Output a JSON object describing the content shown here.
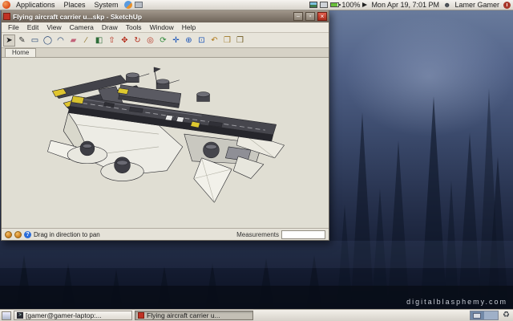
{
  "desktop": {
    "watermark": "digitalblasphemy.com"
  },
  "top_panel": {
    "menus": [
      {
        "label": "Applications"
      },
      {
        "label": "Places"
      },
      {
        "label": "System"
      }
    ],
    "battery_level": "100%",
    "clock": "Mon Apr 19,  7:01 PM",
    "user_name": "Lamer Gamer"
  },
  "window": {
    "title": "Flying aircraft carrier u...skp - SketchUp",
    "menu_items": [
      "File",
      "Edit",
      "View",
      "Camera",
      "Draw",
      "Tools",
      "Window",
      "Help"
    ],
    "tab_label": "Home",
    "controls": {
      "minimize_glyph": "–",
      "maximize_glyph": "▫",
      "close_glyph": "×"
    },
    "toolbar_icons": [
      {
        "name": "select-tool-icon",
        "glyph": "➤",
        "color": "#222222"
      },
      {
        "name": "line-tool-icon",
        "glyph": "✎",
        "color": "#333333"
      },
      {
        "name": "rectangle-tool-icon",
        "glyph": "▭",
        "color": "#1d3f72"
      },
      {
        "name": "circle-tool-icon",
        "glyph": "◯",
        "color": "#1d3f72"
      },
      {
        "name": "arc-tool-icon",
        "glyph": "◠",
        "color": "#1d3f72"
      },
      {
        "name": "eraser-tool-icon",
        "glyph": "▰",
        "color": "#c2637a"
      },
      {
        "name": "tape-measure-tool-icon",
        "glyph": "∕",
        "color": "#8a6d1f"
      },
      {
        "name": "paint-bucket-tool-icon",
        "glyph": "◧",
        "color": "#2f6e3a"
      },
      {
        "name": "push-pull-tool-icon",
        "glyph": "⇧",
        "color": "#b5301f"
      },
      {
        "name": "move-tool-icon",
        "glyph": "✥",
        "color": "#b5301f"
      },
      {
        "name": "rotate-tool-icon",
        "glyph": "↻",
        "color": "#b5301f"
      },
      {
        "name": "offset-tool-icon",
        "glyph": "◎",
        "color": "#b5301f"
      },
      {
        "name": "orbit-tool-icon",
        "glyph": "⟳",
        "color": "#2f8a3a"
      },
      {
        "name": "pan-tool-icon",
        "glyph": "✛",
        "color": "#1d56b8"
      },
      {
        "name": "zoom-tool-icon",
        "glyph": "⊕",
        "color": "#1d56b8"
      },
      {
        "name": "zoom-extents-tool-icon",
        "glyph": "⊡",
        "color": "#1d56b8"
      },
      {
        "name": "undo-view-icon",
        "glyph": "↶",
        "color": "#b07818"
      },
      {
        "name": "get-models-icon",
        "glyph": "❒",
        "color": "#a07a28"
      },
      {
        "name": "share-model-icon",
        "glyph": "❒",
        "color": "#6e5a20"
      }
    ],
    "status": {
      "hint": "Drag in direction to pan",
      "help_glyph": "?",
      "measurements_label": "Measurements",
      "measurements_value": ""
    }
  },
  "taskbar": {
    "buttons": [
      {
        "label": "[gamer@gamer-laptop:...",
        "active": false
      },
      {
        "label": "Flying aircraft carrier u...",
        "active": true
      }
    ],
    "workspaces": 2
  },
  "icon_names": [
    "distro-logo-icon",
    "browser-launcher-icon",
    "screenshot-launcher-icon",
    "photo-tray-icon",
    "network-tray-icon",
    "battery-icon",
    "volume-icon",
    "user-icon",
    "power-icon",
    "window-icon",
    "minimize-button",
    "maximize-button",
    "close-button",
    "status-indicator-icon",
    "help-icon",
    "show-desktop-icon",
    "terminal-icon",
    "sketchup-icon",
    "workspace-switcher",
    "trash-icon"
  ]
}
